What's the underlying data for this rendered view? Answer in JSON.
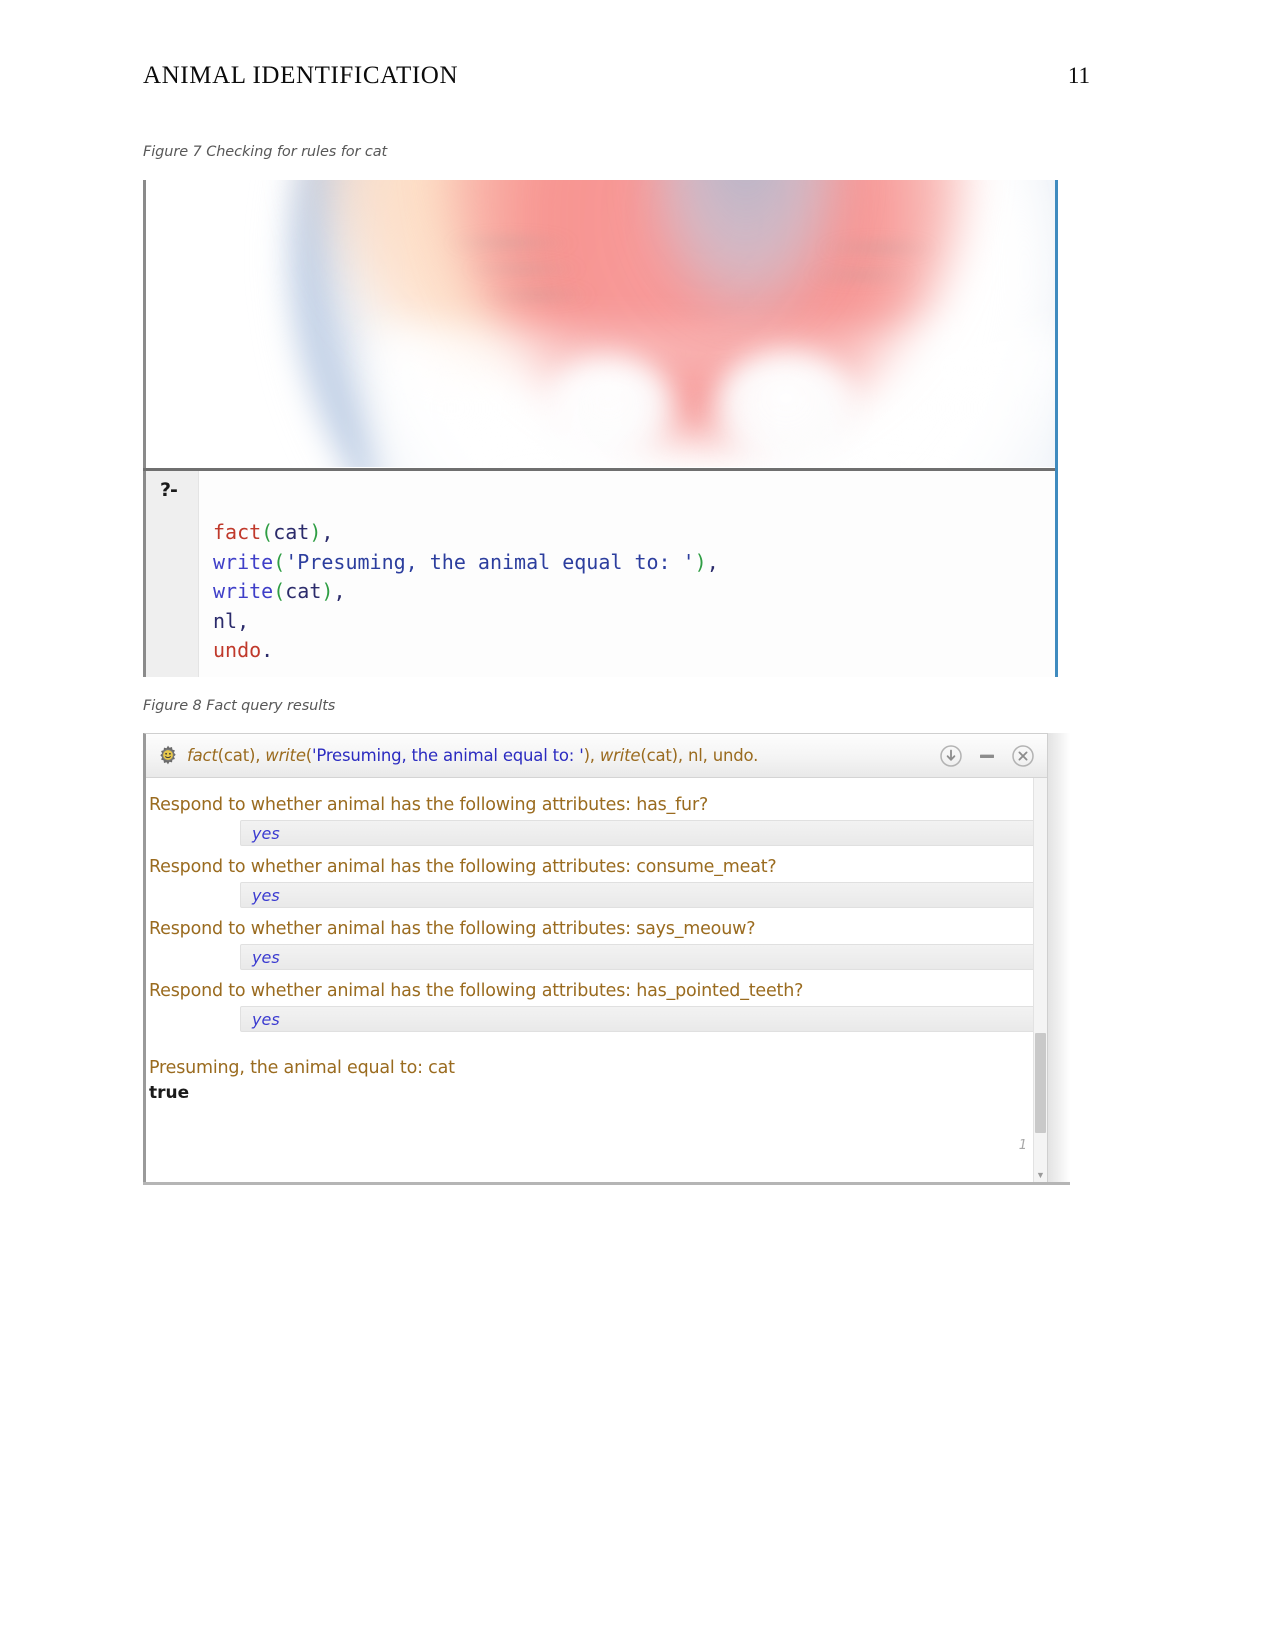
{
  "document": {
    "running_head": "ANIMAL IDENTIFICATION",
    "page_number": "11"
  },
  "figures": [
    {
      "id": "figure-7",
      "caption": "Figure 7 Checking for rules for cat",
      "console": {
        "prompt": "?-",
        "code_lines": [
          {
            "tokens": [
              {
                "text": "fact",
                "role": "predicate"
              },
              {
                "text": "(",
                "role": "paren"
              },
              {
                "text": "cat",
                "role": "plain"
              },
              {
                "text": ")",
                "role": "paren"
              },
              {
                "text": ",",
                "role": "punct"
              }
            ]
          },
          {
            "tokens": [
              {
                "text": "write",
                "role": "function"
              },
              {
                "text": "(",
                "role": "paren"
              },
              {
                "text": "'Presuming, the animal equal to: '",
                "role": "string"
              },
              {
                "text": ")",
                "role": "paren"
              },
              {
                "text": ",",
                "role": "punct"
              }
            ]
          },
          {
            "tokens": [
              {
                "text": "write",
                "role": "function"
              },
              {
                "text": "(",
                "role": "paren"
              },
              {
                "text": "cat",
                "role": "plain"
              },
              {
                "text": ")",
                "role": "paren"
              },
              {
                "text": ",",
                "role": "punct"
              }
            ]
          },
          {
            "tokens": [
              {
                "text": "nl",
                "role": "plain"
              },
              {
                "text": ",",
                "role": "punct"
              }
            ]
          },
          {
            "tokens": [
              {
                "text": "undo",
                "role": "predicate"
              },
              {
                "text": ".",
                "role": "punct"
              }
            ]
          }
        ],
        "code_plain": "fact(cat),\nwrite('Presuming, the animal equal to: '),\nwrite(cat),\nnl,\nundo."
      }
    },
    {
      "id": "figure-8",
      "caption": "Figure 8 Fact query results",
      "dialog": {
        "title_query": "fact(cat), write('Presuming, the animal equal to: '), write(cat), nl, undo.",
        "title_segments": [
          {
            "text": "fact",
            "style": "italic-brown"
          },
          {
            "text": "(cat), ",
            "style": "brown"
          },
          {
            "text": "write",
            "style": "italic-brown"
          },
          {
            "text": "(",
            "style": "brown"
          },
          {
            "text": "'Presuming, the animal equal to: '",
            "style": "blue"
          },
          {
            "text": "), ",
            "style": "brown"
          },
          {
            "text": "write",
            "style": "italic-brown"
          },
          {
            "text": "(cat), nl, undo.",
            "style": "brown"
          }
        ],
        "controls": [
          {
            "name": "download-icon",
            "glyph": "download"
          },
          {
            "name": "minimize-icon",
            "glyph": "minus"
          },
          {
            "name": "close-icon",
            "glyph": "close"
          }
        ],
        "icon": "gear-icon",
        "qa": [
          {
            "question": "Respond to whether animal has the following attributes: has_fur?",
            "answer": "yes"
          },
          {
            "question": "Respond to whether animal has the following attributes: consume_meat?",
            "answer": "yes"
          },
          {
            "question": "Respond to whether animal has the following attributes: says_meouw?",
            "answer": "yes"
          },
          {
            "question": "Respond to whether animal has the following attributes: has_pointed_teeth?",
            "answer": "yes"
          }
        ],
        "conclusion": "Presuming, the animal equal to: cat",
        "verdict": "true",
        "line_number": "1"
      }
    }
  ],
  "colors": {
    "question_text": "#9a6b1f",
    "answer_text": "#3a3ad0",
    "code_predicate": "#c0392b",
    "code_function": "#3f3fc8",
    "code_paren": "#2f9e44",
    "code_string": "#2c3e9e",
    "caption_text": "#585858"
  }
}
